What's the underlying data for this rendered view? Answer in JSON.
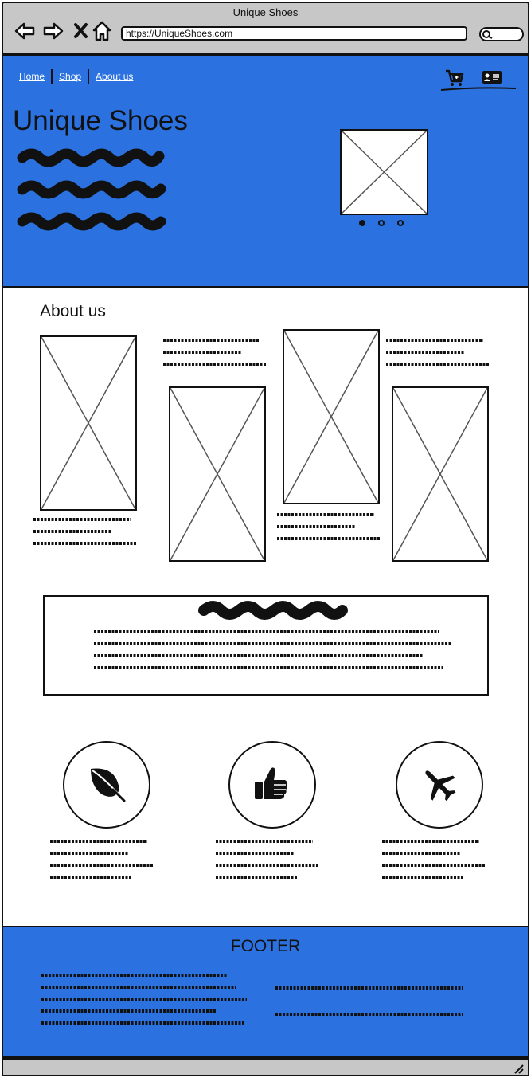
{
  "window": {
    "title": "Unique Shoes"
  },
  "toolbar": {
    "back_icon": "back-arrow-icon",
    "forward_icon": "forward-arrow-icon",
    "close_icon": "close-icon",
    "home_icon": "home-icon",
    "url": "https://UniqueShoes.com",
    "search_icon": "search-icon"
  },
  "nav": {
    "links": [
      "Home",
      "Shop",
      "About us"
    ],
    "cart_icon": "cart-icon",
    "account_icon": "account-card-icon"
  },
  "hero": {
    "title": "Unique Shoes",
    "carousel_total": 3,
    "carousel_active": 1
  },
  "about": {
    "title": "About us"
  },
  "features": [
    {
      "icon": "leaf-icon"
    },
    {
      "icon": "thumbs-up-icon"
    },
    {
      "icon": "airplane-icon"
    }
  ],
  "footer": {
    "title": "FOOTER"
  },
  "colors": {
    "accent": "#2b72e0",
    "chrome": "#c7c7c7",
    "ink": "#111111"
  }
}
